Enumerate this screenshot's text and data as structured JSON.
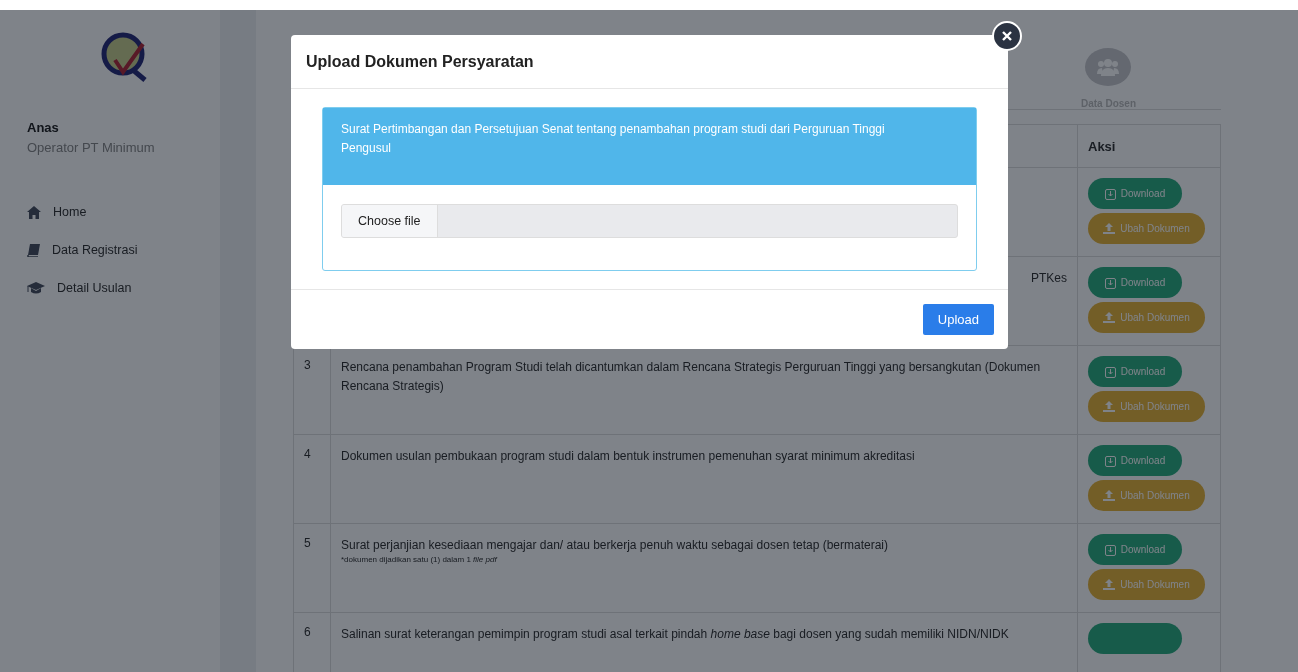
{
  "sidebar": {
    "user_name": "Anas",
    "user_role": "Operator PT Minimum",
    "items": [
      {
        "label": "Home"
      },
      {
        "label": "Data Registrasi"
      },
      {
        "label": "Detail Usulan"
      }
    ]
  },
  "steps": [
    {
      "label": "Data Dosen"
    }
  ],
  "table": {
    "columns": [
      "Aksi"
    ],
    "rows": [
      {
        "kind": "tail",
        "download": "Download",
        "change": "Ubah Dokumen"
      },
      {
        "kind": "tail",
        "text": "PTKes",
        "download": "Download",
        "change": "Ubah Dokumen"
      },
      {
        "kind": "full",
        "no": "3",
        "text": "Rencana penambahan Program Studi telah dicantumkan dalam Rencana Strategis Perguruan Tinggi yang bersangkutan (Dokumen Rencana Strategis)",
        "download": "Download",
        "change": "Ubah Dokumen"
      },
      {
        "kind": "full",
        "no": "4",
        "text": "Dokumen usulan pembukaan program studi dalam bentuk instrumen pemenuhan syarat minimum akreditasi",
        "download": "Download",
        "change": "Ubah Dokumen"
      },
      {
        "kind": "full",
        "no": "5",
        "text": "Surat perjanjian kesediaan mengajar dan/ atau berkerja penuh waktu sebagai dosen tetap (bermaterai)",
        "note": "*dokumen dijadikan satu (1) dalam 1 *file pdf*",
        "download": "Download",
        "change": "Ubah Dokumen"
      },
      {
        "kind": "full",
        "no": "6",
        "text": "Salinan surat keterangan pemimpin program studi asal terkait pindah *home base* bagi dosen yang sudah memiliki NIDN/NIDK"
      }
    ]
  },
  "modal": {
    "title": "Upload Dokumen Persyaratan",
    "document": "Surat Pertimbangan dan Persetujuan Senat tentang penambahan program studi dari Perguruan Tinggi Pengusul",
    "file_button": "Choose file",
    "submit": "Upload"
  }
}
